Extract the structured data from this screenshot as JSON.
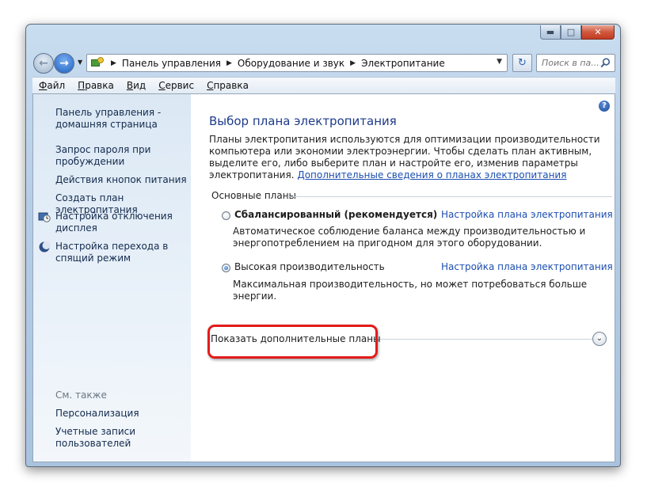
{
  "window": {
    "caption_buttons": {
      "minimize": "▬",
      "maximize": "□",
      "close": "✕"
    }
  },
  "address_bar": {
    "icon": "control-panel-icon",
    "breadcrumbs": [
      "Панель управления",
      "Оборудование и звук",
      "Электропитание"
    ]
  },
  "search": {
    "placeholder": "Поиск в па..."
  },
  "menu": {
    "items": [
      {
        "underline": "Ф",
        "rest": "айл"
      },
      {
        "underline": "П",
        "rest": "равка"
      },
      {
        "underline": "В",
        "rest": "ид"
      },
      {
        "underline": "С",
        "rest": "ервис"
      },
      {
        "underline": "С",
        "rest": "правка"
      }
    ]
  },
  "sidebar": {
    "home_link": "Панель управления - домашняя страница",
    "links": [
      "Запрос пароля при пробуждении",
      "Действия кнопок питания",
      "Создать план электропитания",
      "Настройка отключения дисплея",
      "Настройка перехода в спящий режим"
    ],
    "see_also_heading": "См. также",
    "see_also": [
      "Персонализация",
      "Учетные записи пользователей"
    ]
  },
  "main": {
    "title": "Выбор плана электропитания",
    "intro": "Планы электропитания используются для оптимизации производительности компьютера или экономии электроэнергии. Чтобы сделать план активным, выделите его, либо выберите план и настройте его, изменив параметры электропитания.",
    "intro_link": "Дополнительные сведения о планах электропитания",
    "group_label": "Основные планы",
    "plans": [
      {
        "name": "Сбалансированный (рекомендуется)",
        "selected": false,
        "settings_link": "Настройка плана электропитания",
        "description": "Автоматическое соблюдение баланса между производительностью и энергопотреблением на пригодном для этого оборудовании."
      },
      {
        "name": "Высокая производительность",
        "selected": true,
        "settings_link": "Настройка плана электропитания",
        "description": "Максимальная производительность, но может потребоваться больше энергии."
      }
    ],
    "show_more": "Показать дополнительные планы",
    "highlight_color": "#e21b1b"
  }
}
